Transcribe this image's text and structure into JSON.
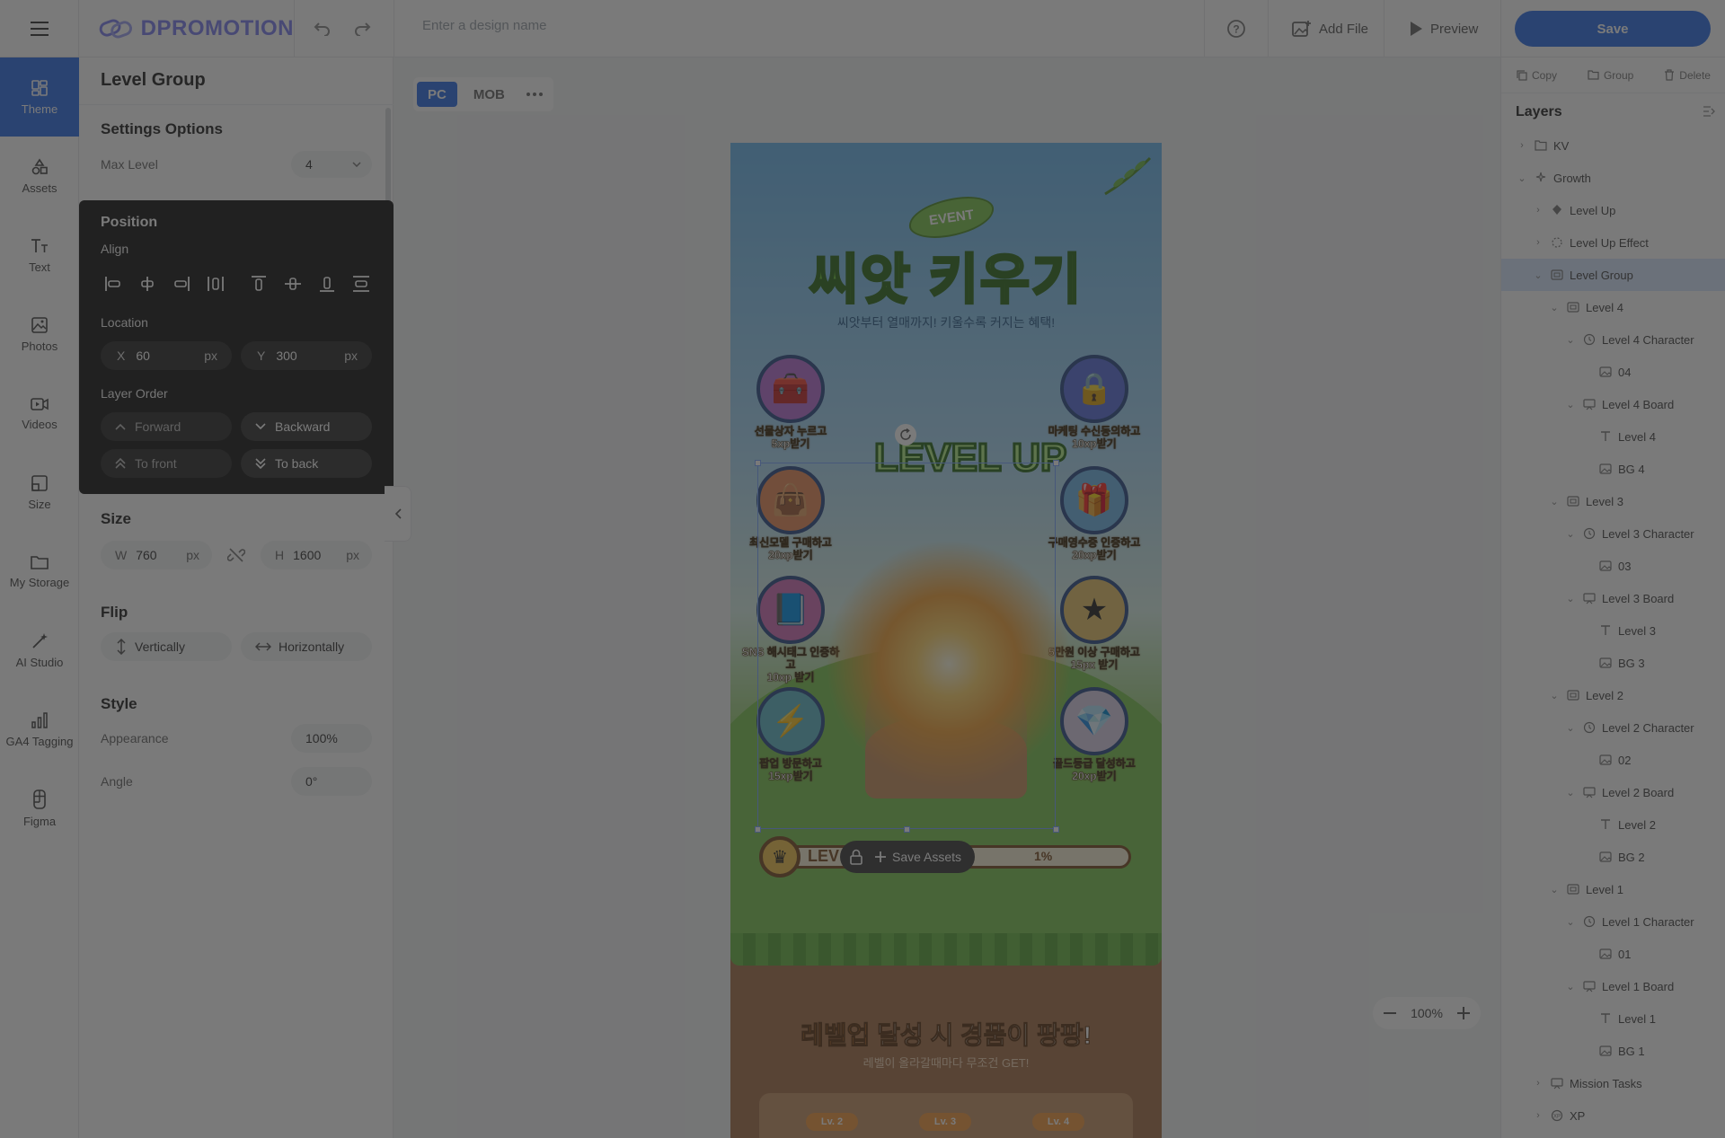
{
  "topbar": {
    "logo_text": "DPROMOTION",
    "design_name_placeholder": "Enter a design name",
    "add_file_label": "Add File",
    "preview_label": "Preview",
    "save_label": "Save"
  },
  "rail": {
    "items": [
      {
        "label": "Theme",
        "icon": "theme-icon",
        "active": true
      },
      {
        "label": "Assets",
        "icon": "shapes-icon"
      },
      {
        "label": "Text",
        "icon": "text-icon"
      },
      {
        "label": "Photos",
        "icon": "photo-icon"
      },
      {
        "label": "Videos",
        "icon": "video-icon"
      },
      {
        "label": "Size",
        "icon": "resize-icon"
      },
      {
        "label": "My Storage",
        "icon": "folder-icon"
      },
      {
        "label": "AI Studio",
        "icon": "magic-wand-icon"
      },
      {
        "label": "GA4 Tagging",
        "icon": "bar-chart-icon"
      },
      {
        "label": "Figma",
        "icon": "figma-icon"
      }
    ]
  },
  "panel": {
    "title": "Level Group",
    "settings_title": "Settings Options",
    "max_level_label": "Max Level",
    "max_level_value": "4",
    "size_title": "Size",
    "w_prefix": "W",
    "w_value": "760",
    "h_prefix": "H",
    "h_value": "1600",
    "unit": "px",
    "flip_title": "Flip",
    "flip_vertical": "Vertically",
    "flip_horizontal": "Horizontally",
    "style_title": "Style",
    "appearance_label": "Appearance",
    "appearance_value": "100%",
    "angle_label": "Angle",
    "angle_value": "0°"
  },
  "position_popover": {
    "title": "Position",
    "align_label": "Align",
    "location_label": "Location",
    "x_prefix": "X",
    "x_value": "60",
    "y_prefix": "Y",
    "y_value": "300",
    "unit": "px",
    "layer_order_label": "Layer Order",
    "forward": "Forward",
    "backward": "Backward",
    "to_front": "To front",
    "to_back": "To back"
  },
  "canvas": {
    "device_tabs": [
      "PC",
      "MOB"
    ],
    "active_device": "PC",
    "zoom_value": "100%",
    "save_assets_label": "Save Assets"
  },
  "artwork": {
    "event_label": "EVENT",
    "headline": "씨앗 키우기",
    "subline": "씨앗부터 열매까지! 키울수록 커지는 혜택!",
    "missions": [
      {
        "caption_1": "선물상자 누르고",
        "caption_2": "5xp받기",
        "icon": "treasure-chest-icon",
        "color": "#b86fd6"
      },
      {
        "caption_1": "마케팅 수신동의하고",
        "caption_2": "10xp받기",
        "icon": "padlock-icon",
        "color": "#5a6fdc"
      },
      {
        "caption_1": "최신모델 구매하고",
        "caption_2": "20xp받기",
        "icon": "shopping-bag-icon",
        "color": "#e98d5a"
      },
      {
        "caption_1": "구매영수증 인증하고",
        "caption_2": "20xp받기",
        "icon": "gift-box-icon",
        "color": "#6fb6e8"
      },
      {
        "caption_1": "SNS 해시태그 인증하고",
        "caption_2": "10xp 받기",
        "icon": "book-icon",
        "color": "#d36fb8"
      },
      {
        "caption_1": "5만원 이상 구매하고",
        "caption_2": "15px 받기",
        "icon": "star-coin-icon",
        "color": "#e6c36a"
      },
      {
        "caption_1": "팝업 방문하고",
        "caption_2": "15xp받기",
        "icon": "lightning-icon",
        "color": "#5fb7c9"
      },
      {
        "caption_1": "골드등급 달성하고",
        "caption_2": "20xp받기",
        "icon": "gem-icon",
        "color": "#d9d0e8"
      }
    ],
    "levelup_text": "LEVEL UP",
    "progress_label": "LEV",
    "progress_percent": "1%",
    "reward_title_accent": "레벨업",
    "reward_title_rest": " 달성 시 경품이 팡팡!",
    "reward_sub": "레벨이 올라갈때마다 무조건 GET!",
    "level_chips": [
      "Lv. 2",
      "Lv. 3",
      "Lv. 4"
    ]
  },
  "layers": {
    "toolbar": [
      "Copy",
      "Group",
      "Delete"
    ],
    "title": "Layers",
    "rows": [
      {
        "label": "KV",
        "depth": 0,
        "chevron": "right",
        "icon": "folder-icon"
      },
      {
        "label": "Growth",
        "depth": 0,
        "chevron": "down",
        "icon": "sparkle-icon"
      },
      {
        "label": "Level Up",
        "depth": 1,
        "chevron": "right",
        "icon": "diamond-icon"
      },
      {
        "label": "Level Up Effect",
        "depth": 1,
        "chevron": "right",
        "icon": "burst-icon"
      },
      {
        "label": "Level Group",
        "depth": 1,
        "chevron": "down",
        "icon": "group-icon",
        "selected": true
      },
      {
        "label": "Level 4",
        "depth": 2,
        "chevron": "down",
        "icon": "group-icon"
      },
      {
        "label": "Level 4 Character",
        "depth": 3,
        "chevron": "down",
        "icon": "clock-icon"
      },
      {
        "label": "04",
        "depth": 4,
        "chevron": "",
        "icon": "image-icon"
      },
      {
        "label": "Level 4 Board",
        "depth": 3,
        "chevron": "down",
        "icon": "board-icon"
      },
      {
        "label": "Level 4",
        "depth": 4,
        "chevron": "",
        "icon": "text-icon"
      },
      {
        "label": "BG 4",
        "depth": 4,
        "chevron": "",
        "icon": "image-icon"
      },
      {
        "label": "Level 3",
        "depth": 2,
        "chevron": "down",
        "icon": "group-icon"
      },
      {
        "label": "Level 3 Character",
        "depth": 3,
        "chevron": "down",
        "icon": "clock-icon"
      },
      {
        "label": "03",
        "depth": 4,
        "chevron": "",
        "icon": "image-icon"
      },
      {
        "label": "Level 3 Board",
        "depth": 3,
        "chevron": "down",
        "icon": "board-icon"
      },
      {
        "label": "Level 3",
        "depth": 4,
        "chevron": "",
        "icon": "text-icon"
      },
      {
        "label": "BG 3",
        "depth": 4,
        "chevron": "",
        "icon": "image-icon"
      },
      {
        "label": "Level 2",
        "depth": 2,
        "chevron": "down",
        "icon": "group-icon"
      },
      {
        "label": "Level 2 Character",
        "depth": 3,
        "chevron": "down",
        "icon": "clock-icon"
      },
      {
        "label": "02",
        "depth": 4,
        "chevron": "",
        "icon": "image-icon"
      },
      {
        "label": "Level 2 Board",
        "depth": 3,
        "chevron": "down",
        "icon": "board-icon"
      },
      {
        "label": "Level 2",
        "depth": 4,
        "chevron": "",
        "icon": "text-icon"
      },
      {
        "label": "BG 2",
        "depth": 4,
        "chevron": "",
        "icon": "image-icon"
      },
      {
        "label": "Level 1",
        "depth": 2,
        "chevron": "down",
        "icon": "group-icon"
      },
      {
        "label": "Level 1 Character",
        "depth": 3,
        "chevron": "down",
        "icon": "clock-icon"
      },
      {
        "label": "01",
        "depth": 4,
        "chevron": "",
        "icon": "image-icon"
      },
      {
        "label": "Level 1 Board",
        "depth": 3,
        "chevron": "down",
        "icon": "board-icon"
      },
      {
        "label": "Level 1",
        "depth": 4,
        "chevron": "",
        "icon": "text-icon"
      },
      {
        "label": "BG 1",
        "depth": 4,
        "chevron": "",
        "icon": "image-icon"
      },
      {
        "label": "Mission Tasks",
        "depth": 1,
        "chevron": "right",
        "icon": "board-icon"
      },
      {
        "label": "XP",
        "depth": 1,
        "chevron": "right",
        "icon": "xp-icon"
      }
    ]
  },
  "colors": {
    "accent": "#2f6fe6",
    "selection_bg": "#d8e6ff",
    "popover_bg": "#161616",
    "overlay": "rgba(40,40,40,0.62)"
  }
}
